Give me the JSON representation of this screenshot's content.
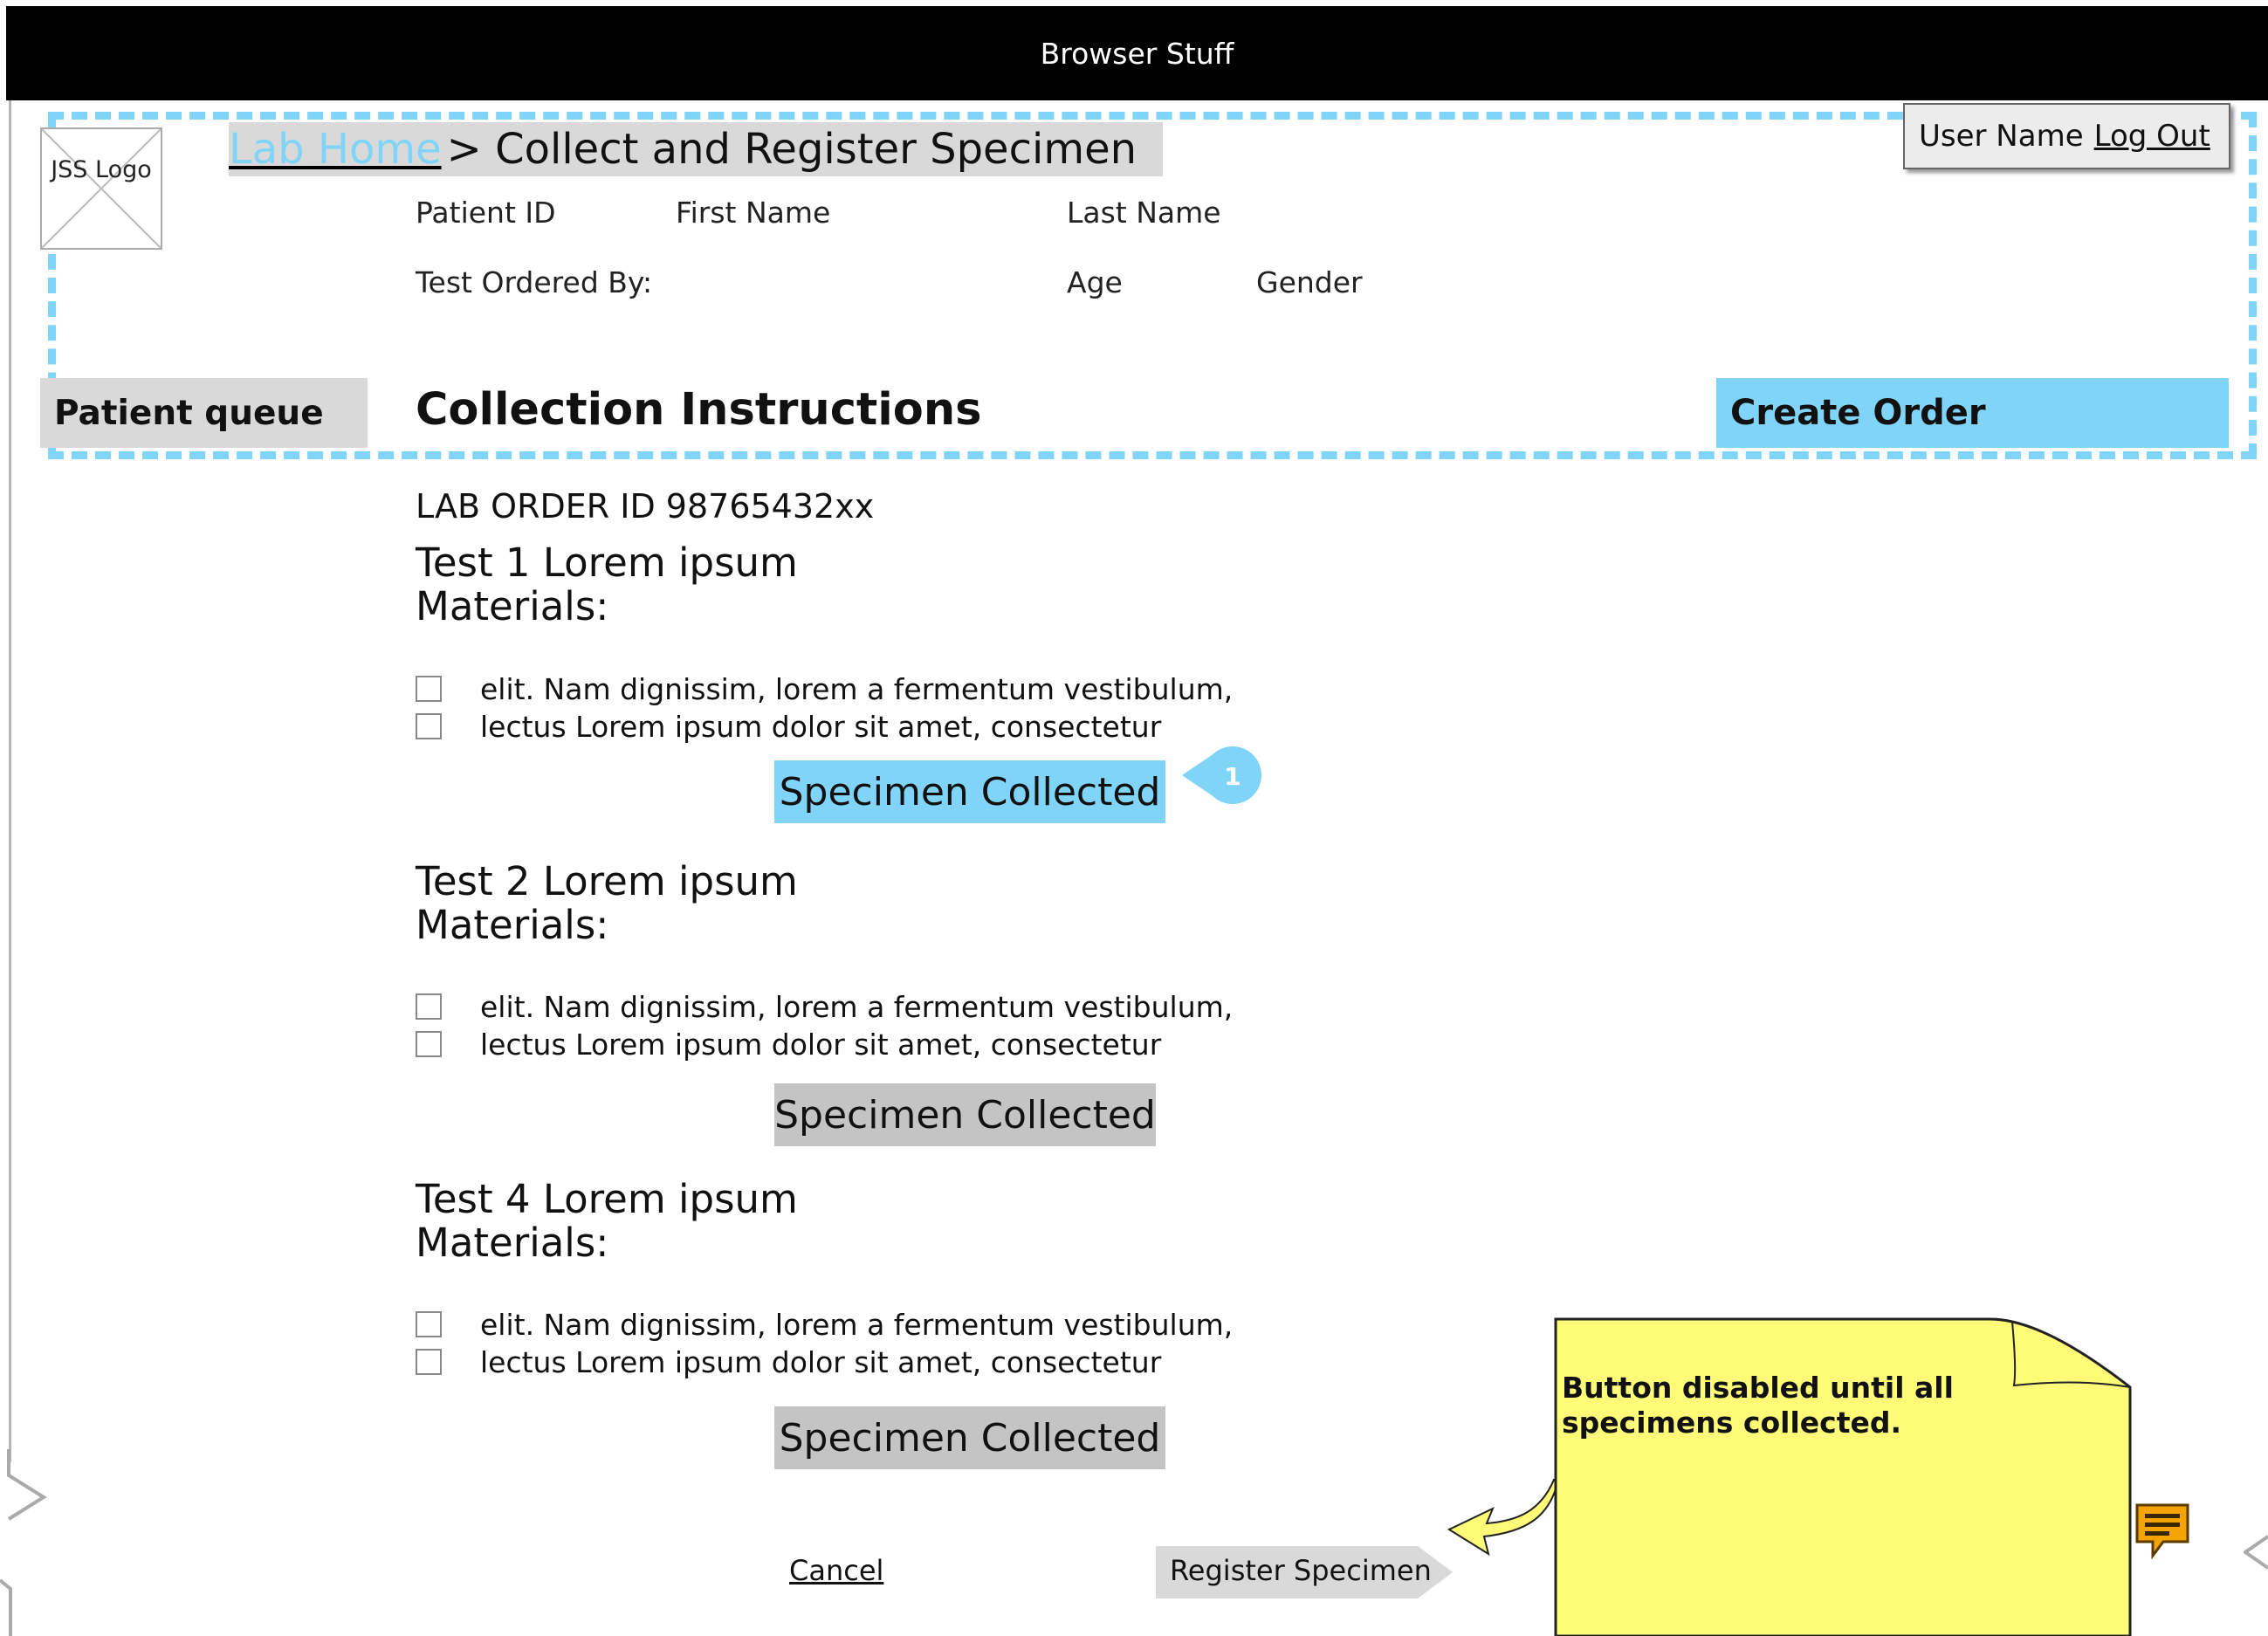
{
  "browser": {
    "title": "Browser Stuff"
  },
  "header": {
    "logo": "JSS Logo",
    "breadcrumb_link": "Lab Home",
    "breadcrumb_rest": "> Collect and Register Specimen",
    "user_name": "User Name",
    "logout": "Log Out"
  },
  "patient": {
    "patient_id_label": "Patient ID",
    "first_name_label": "First Name",
    "last_name_label": "Last Name",
    "test_ordered_by_label": "Test Ordered By:",
    "age_label": "Age",
    "gender_label": "Gender"
  },
  "nav": {
    "patient_queue": "Patient queue",
    "section_title": "Collection Instructions",
    "create_order": "Create Order"
  },
  "order": {
    "lab_order_id": "LAB ORDER ID 98765432xx",
    "tests": [
      {
        "title": "Test 1 Lorem ipsum",
        "materials_label": "Materials:",
        "materials": [
          "elit. Nam dignissim, lorem a fermentum vestibulum,",
          "lectus Lorem ipsum dolor sit amet, consectetur"
        ],
        "button": "Specimen Collected"
      },
      {
        "title": "Test 2 Lorem ipsum",
        "materials_label": "Materials:",
        "materials": [
          "elit. Nam dignissim, lorem a fermentum vestibulum,",
          "lectus Lorem ipsum dolor sit amet, consectetur"
        ],
        "button": "Specimen Collected"
      },
      {
        "title": "Test 4 Lorem ipsum",
        "materials_label": "Materials:",
        "materials": [
          "elit. Nam dignissim, lorem a fermentum vestibulum,",
          "lectus Lorem ipsum dolor sit amet, consectetur"
        ],
        "button": "Specimen Collected"
      }
    ]
  },
  "callout": {
    "number": "1"
  },
  "actions": {
    "cancel": "Cancel",
    "register": "Register Specimen"
  },
  "note": {
    "text": "Button disabled until all specimens collected."
  },
  "colors": {
    "accent": "#7fd4f7",
    "disabled": "#c4c4c4",
    "sticky": "#fffa78",
    "header_bg": "#d9d9d9"
  },
  "icons": {
    "logo": "image-placeholder-icon",
    "note": "comment-icon",
    "arrow": "curved-arrow-icon"
  }
}
